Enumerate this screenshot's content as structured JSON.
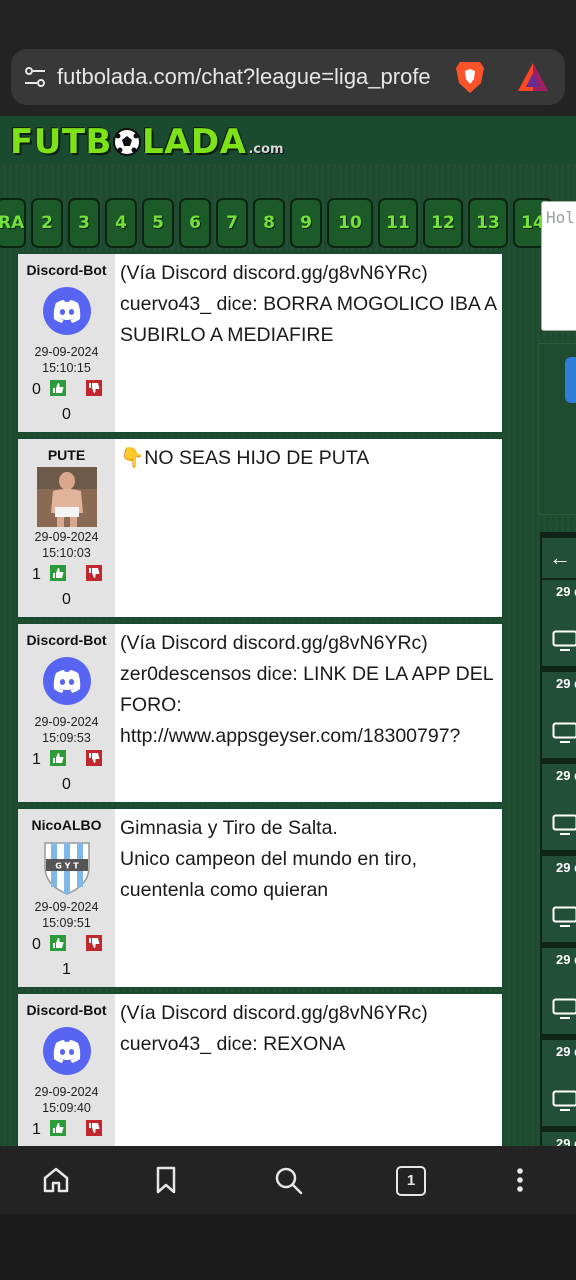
{
  "browser": {
    "url": "futbolada.com/chat?league=liga_profe",
    "tab_count": "1"
  },
  "site": {
    "logo_text_a": "FUTB",
    "logo_text_b": "LADA",
    "logo_suffix": ".com"
  },
  "pager": [
    "RA",
    "2",
    "3",
    "4",
    "5",
    "6",
    "7",
    "8",
    "9",
    "10",
    "11",
    "12",
    "13",
    "14"
  ],
  "compose": {
    "placeholder": "Hol"
  },
  "messages": [
    {
      "user": "Discord-Bot",
      "avatar": "discord-logo",
      "date": "29-09-2024",
      "time": "15:10:15",
      "up": "0",
      "down": "0",
      "text": "(Vía Discord discord.gg/g8vN6YRc) cuervo43_ dice: BORRA MOGOLICO IBA A SUBIRLO A MEDIAFIRE"
    },
    {
      "user": "PUTE",
      "avatar": "photo",
      "date": "29-09-2024",
      "time": "15:10:03",
      "up": "1",
      "down": "0",
      "text": "👇NO SEAS HIJO DE PUTA"
    },
    {
      "user": "Discord-Bot",
      "avatar": "discord-logo",
      "date": "29-09-2024",
      "time": "15:09:53",
      "up": "1",
      "down": "0",
      "text": "(Vía Discord discord.gg/g8vN6YRc) zer0descensos dice: LINK DE LA APP DEL FORO: http://www.appsgeyser.com/18300797?"
    },
    {
      "user": "NicoALBO",
      "avatar": "gyt-crest",
      "date": "29-09-2024",
      "time": "15:09:51",
      "up": "0",
      "down": "1",
      "text_lines": [
        "Gimnasia y Tiro de Salta.",
        "Unico campeon del mundo en tiro, cuentenla como quieran"
      ]
    },
    {
      "user": "Discord-Bot",
      "avatar": "discord-logo",
      "date": "29-09-2024",
      "time": "15:09:40",
      "up": "1",
      "down": "",
      "text": "(Vía Discord discord.gg/g8vN6YRc) cuervo43_ dice: REXONA"
    }
  ],
  "notifications": {
    "back": "←",
    "items": [
      "29 d",
      "29 d",
      "29 d",
      "29 d",
      "29 d",
      "29 d",
      "29 d"
    ]
  },
  "colors": {
    "discord": "#5865F2",
    "vote_up": "#2e9b3a",
    "vote_down": "#c0282d",
    "accent_green": "#7ee21a"
  }
}
